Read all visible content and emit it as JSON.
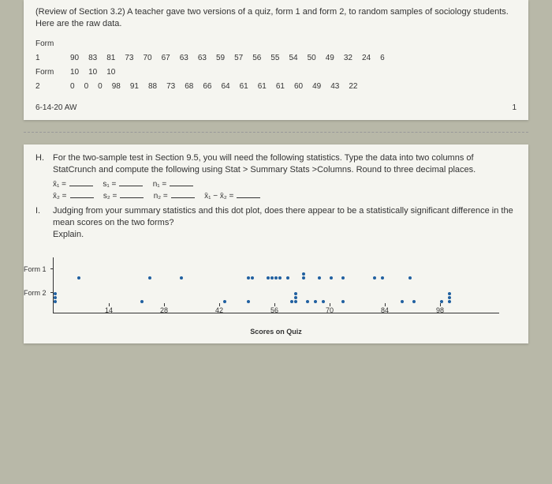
{
  "top": {
    "intro": "(Review of Section 3.2) A teacher gave two versions of a quiz, form 1 and form 2, to random samples of sociology students. Here are the raw data.",
    "form_label": "Form",
    "row1_label": "1",
    "row1_vals": [
      "90",
      "83",
      "81",
      "73",
      "70",
      "67",
      "63",
      "63",
      "59",
      "57",
      "56",
      "55",
      "54",
      "50",
      "49",
      "32",
      "24",
      "6"
    ],
    "row_mid_label": "Form",
    "row_mid_vals": [
      "10",
      "10",
      "10"
    ],
    "row2_label": "2",
    "row2_vals": [
      "0",
      "0",
      "0",
      "98",
      "91",
      "88",
      "73",
      "68",
      "66",
      "64",
      "61",
      "61",
      "61",
      "60",
      "49",
      "43",
      "22"
    ],
    "date": "6-14-20 AW",
    "page_num": "1"
  },
  "bottom": {
    "H_letter": "H.",
    "H_text": "For the two-sample test in Section 9.5, you will need the following statistics. Type the data into two columns of StatCrunch and compute the following using Stat > Summary Stats >Columns. Round to three decimal places.",
    "stat1": {
      "x": "x̄₁ =",
      "s": "s₁ =",
      "n": "n₁ ="
    },
    "stat2": {
      "x": "x̄₂ =",
      "s": "s₂ =",
      "n": "n₂ =",
      "diff": "x̄₁ − x̄₂ ="
    },
    "I_letter": "I.",
    "I_text": "Judging from your summary statistics and this dot plot, does there appear to be a statistically significant difference in the mean scores on the two forms?",
    "explain": "Explain.",
    "form1_label": "Form 1",
    "form2_label": "Form 2",
    "xlabel": "Scores on Quiz"
  },
  "chart_data": {
    "type": "dotplot",
    "xlabel": "Scores on Quiz",
    "xlim": [
      0,
      100
    ],
    "xticks": [
      14,
      28,
      42,
      56,
      70,
      84,
      98
    ],
    "series": [
      {
        "name": "Form 1",
        "values": [
          90,
          83,
          81,
          73,
          70,
          67,
          63,
          63,
          59,
          57,
          56,
          55,
          54,
          50,
          49,
          32,
          24,
          6
        ]
      },
      {
        "name": "Form 2",
        "values": [
          100,
          100,
          100,
          0,
          0,
          0,
          98,
          91,
          88,
          73,
          68,
          66,
          64,
          61,
          61,
          61,
          60,
          49,
          43,
          22
        ]
      }
    ]
  }
}
